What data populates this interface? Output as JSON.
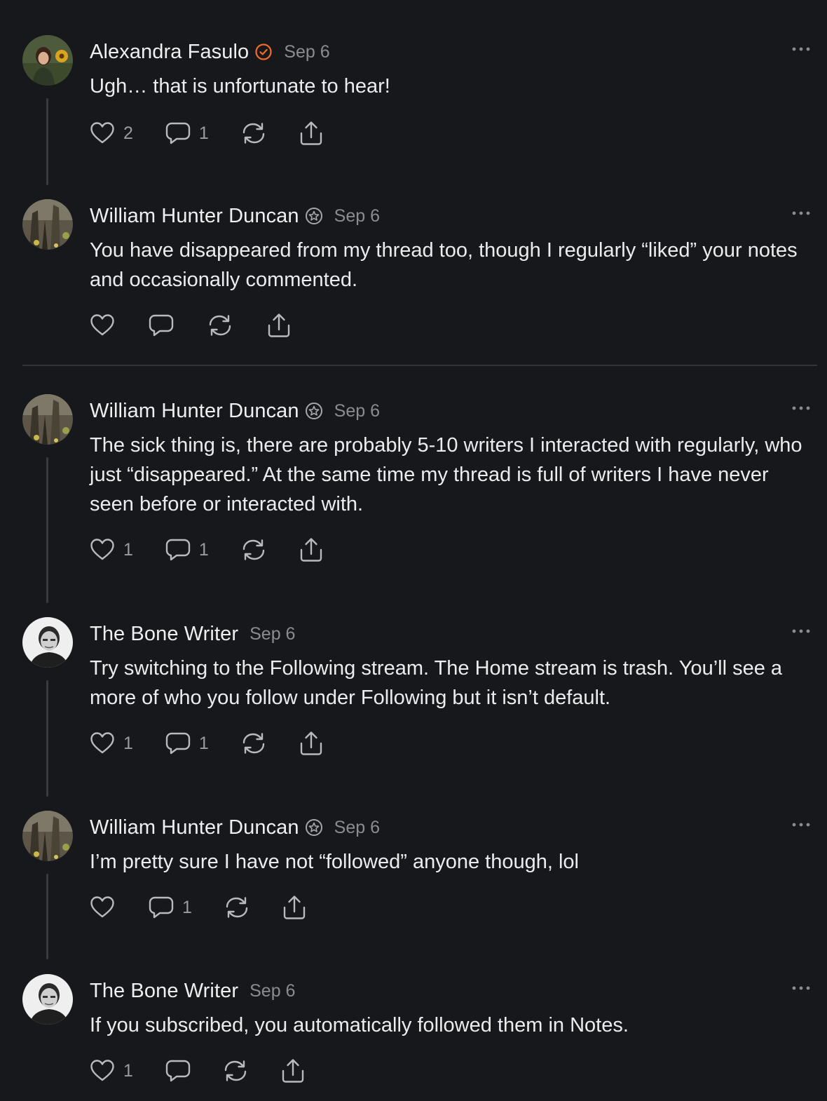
{
  "notes": [
    {
      "author": "Alexandra Fasulo",
      "badge": "checkmark-badge",
      "date": "Sep 6",
      "body": "Ugh… that is unfortunate to hear!",
      "likes": "2",
      "comments": "1",
      "avatar": "alexandra"
    },
    {
      "author": "William Hunter Duncan",
      "badge": "star-badge",
      "date": "Sep 6",
      "body": "You have disappeared from my thread too, though I regularly “liked” your notes and occasionally commented.",
      "likes": "",
      "comments": "",
      "avatar": "william"
    },
    {
      "author": "William Hunter Duncan",
      "badge": "star-badge",
      "date": "Sep 6",
      "body": "The sick thing is, there are probably 5-10 writers I interacted with regularly, who just “disappeared.” At the same time my thread is full of writers I have never seen before or interacted with.",
      "likes": "1",
      "comments": "1",
      "avatar": "william"
    },
    {
      "author": "The Bone Writer",
      "badge": "",
      "date": "Sep 6",
      "body": "Try switching to the Following stream. The Home stream is trash. You’ll see a more of who you follow under Following but it isn’t default.",
      "likes": "1",
      "comments": "1",
      "avatar": "bone"
    },
    {
      "author": "William Hunter Duncan",
      "badge": "star-badge",
      "date": "Sep 6",
      "body": "I’m pretty sure I have not “followed” anyone though, lol",
      "likes": "",
      "comments": "1",
      "avatar": "william"
    },
    {
      "author": "The Bone Writer",
      "badge": "",
      "date": "Sep 6",
      "body": "If you subscribed, you automatically followed them in Notes.",
      "likes": "1",
      "comments": "",
      "avatar": "bone"
    }
  ],
  "colors": {
    "background": "#17181b",
    "text": "#ececed",
    "muted": "#8b8c91",
    "icon": "#b9babe",
    "verified_orange": "#f26a2a"
  },
  "icons": [
    "heart-icon",
    "comment-icon",
    "restack-icon",
    "share-icon",
    "more-icon"
  ]
}
